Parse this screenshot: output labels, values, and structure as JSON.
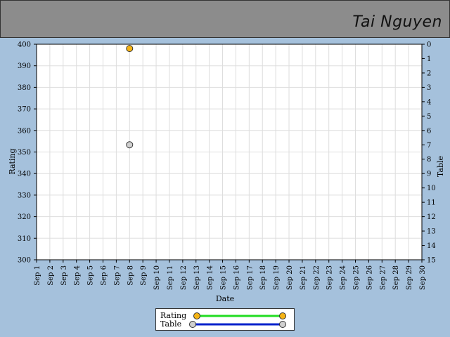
{
  "header": {
    "name": "Tai Nguyen"
  },
  "chart_data": {
    "type": "scatter",
    "x_categories": [
      "Sep 1",
      "Sep 2",
      "Sep 3",
      "Sep 4",
      "Sep 5",
      "Sep 6",
      "Sep 7",
      "Sep 8",
      "Sep 9",
      "Sep 10",
      "Sep 11",
      "Sep 12",
      "Sep 13",
      "Sep 14",
      "Sep 15",
      "Sep 16",
      "Sep 17",
      "Sep 18",
      "Sep 19",
      "Sep 20",
      "Sep 21",
      "Sep 22",
      "Sep 23",
      "Sep 24",
      "Sep 25",
      "Sep 26",
      "Sep 27",
      "Sep 28",
      "Sep 29",
      "Sep 30"
    ],
    "xlabel": "Date",
    "ylabel_left": "Rating",
    "ylabel_right": "Table",
    "y_left_range": [
      300,
      400
    ],
    "y_left_ticks": [
      300,
      310,
      320,
      330,
      340,
      350,
      360,
      370,
      380,
      390,
      400
    ],
    "y_right_range": [
      15,
      0
    ],
    "y_right_ticks": [
      0,
      1,
      2,
      3,
      4,
      5,
      6,
      7,
      8,
      9,
      10,
      11,
      12,
      13,
      14,
      15
    ],
    "grid": true,
    "series": [
      {
        "name": "Rating",
        "axis": "left",
        "line_color": "#22dd22",
        "marker_color": "#f5b314",
        "points": [
          {
            "x": "Sep 8",
            "y": 398
          }
        ]
      },
      {
        "name": "Table",
        "axis": "right",
        "line_color": "#0022cc",
        "marker_color": "#d0d0d0",
        "points": [
          {
            "x": "Sep 8",
            "y": 7
          }
        ]
      }
    ]
  }
}
